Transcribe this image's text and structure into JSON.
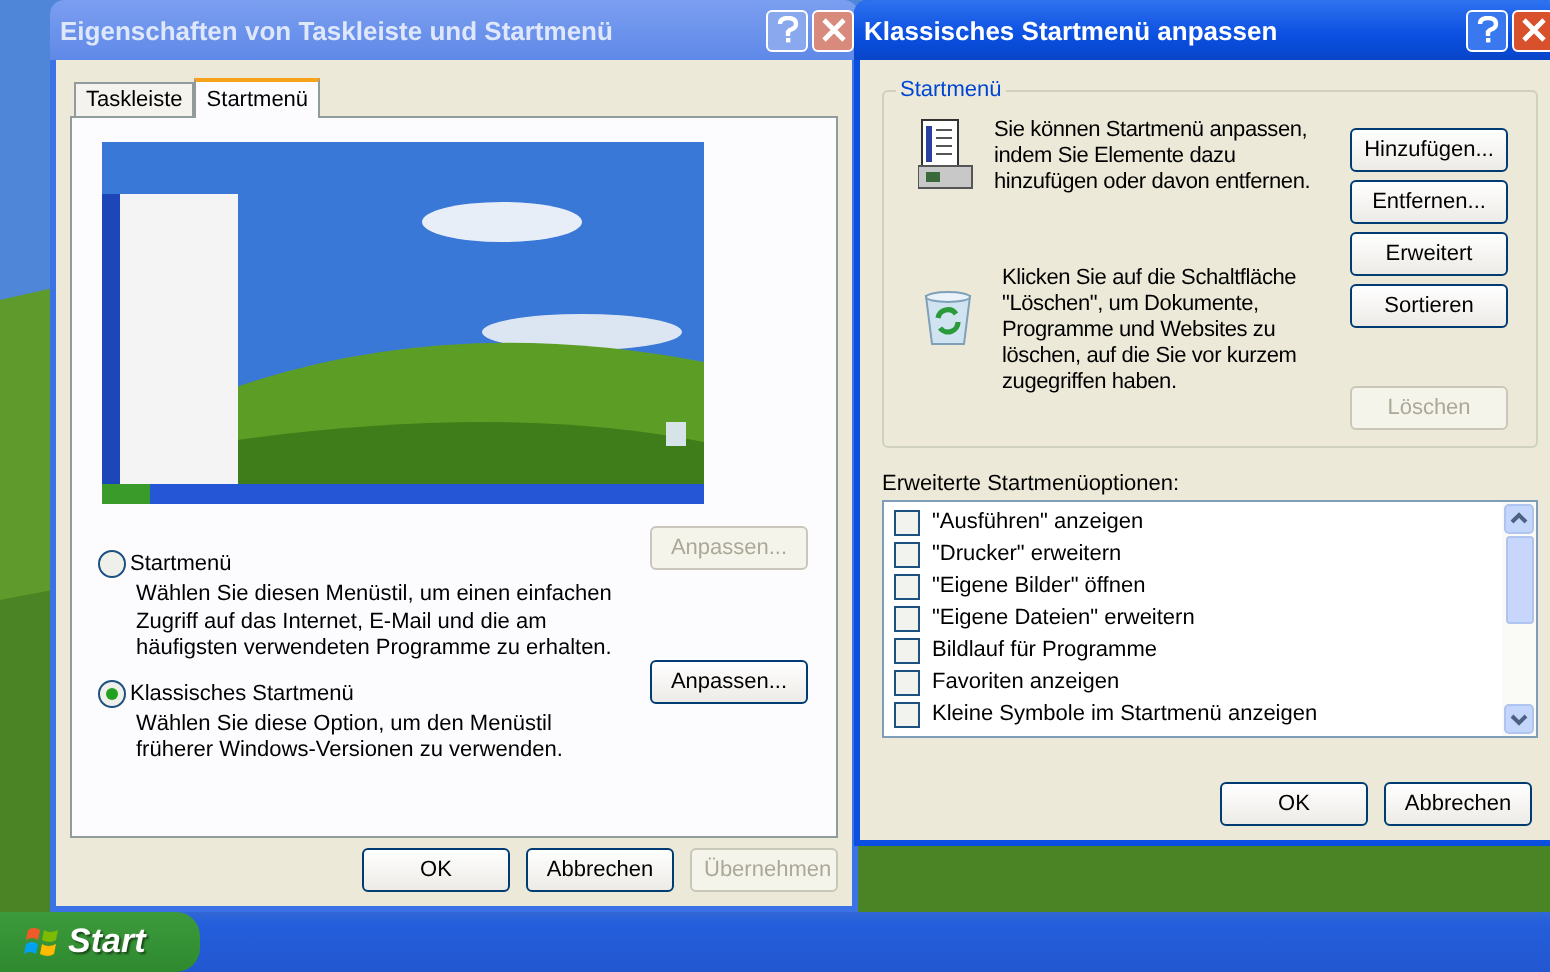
{
  "properties_dialog": {
    "title": "Eigenschaften von Taskleiste und Startmenü",
    "tabs": [
      {
        "label": "Taskleiste",
        "selected": false
      },
      {
        "label": "Startmenü",
        "selected": true
      }
    ],
    "options": [
      {
        "label": "Startmenü",
        "selected": false,
        "description": "Wählen Sie diesen Menüstil, um einen einfachen Zugriff auf das Internet, E-Mail und die am häufigsten verwendeten Programme zu erhalten.",
        "button": {
          "label": "Anpassen...",
          "disabled": true
        }
      },
      {
        "label": "Klassisches Startmenü",
        "selected": true,
        "description": "Wählen Sie diese Option, um den Menüstil früherer Windows-Versionen zu verwenden.",
        "button": {
          "label": "Anpassen...",
          "disabled": false
        }
      }
    ],
    "buttons": [
      {
        "label": "OK",
        "disabled": false
      },
      {
        "label": "Abbrechen",
        "disabled": false
      },
      {
        "label": "Übernehmen",
        "disabled": true
      }
    ]
  },
  "customize_dialog": {
    "title": "Klassisches Startmenü anpassen",
    "group_title": "Startmenü",
    "edit_text": "Sie können Startmenü anpassen, indem Sie Elemente dazu hinzufügen oder davon entfernen.",
    "clear_text": "Klicken Sie auf die Schaltfläche \"Löschen\", um Dokumente, Programme und Websites zu löschen, auf die Sie vor kurzem zugegriffen haben.",
    "side_buttons": [
      {
        "label": "Hinzufügen...",
        "disabled": false
      },
      {
        "label": "Entfernen...",
        "disabled": false
      },
      {
        "label": "Erweitert",
        "disabled": false
      },
      {
        "label": "Sortieren",
        "disabled": false
      }
    ],
    "clear_button": {
      "label": "Löschen",
      "disabled": true
    },
    "options_label": "Erweiterte Startmenüoptionen:",
    "options": [
      {
        "label": "\"Ausführen\" anzeigen",
        "checked": false
      },
      {
        "label": "\"Drucker\" erweitern",
        "checked": false
      },
      {
        "label": "\"Eigene Bilder\" öffnen",
        "checked": false
      },
      {
        "label": "\"Eigene Dateien\" erweitern",
        "checked": false
      },
      {
        "label": "Bildlauf für Programme",
        "checked": false
      },
      {
        "label": "Favoriten anzeigen",
        "checked": false
      },
      {
        "label": "Kleine Symbole im Startmenü anzeigen",
        "checked": false
      }
    ],
    "buttons": [
      {
        "label": "OK",
        "disabled": false
      },
      {
        "label": "Abbrechen",
        "disabled": false
      }
    ]
  },
  "taskbar": {
    "start_label": "Start"
  }
}
